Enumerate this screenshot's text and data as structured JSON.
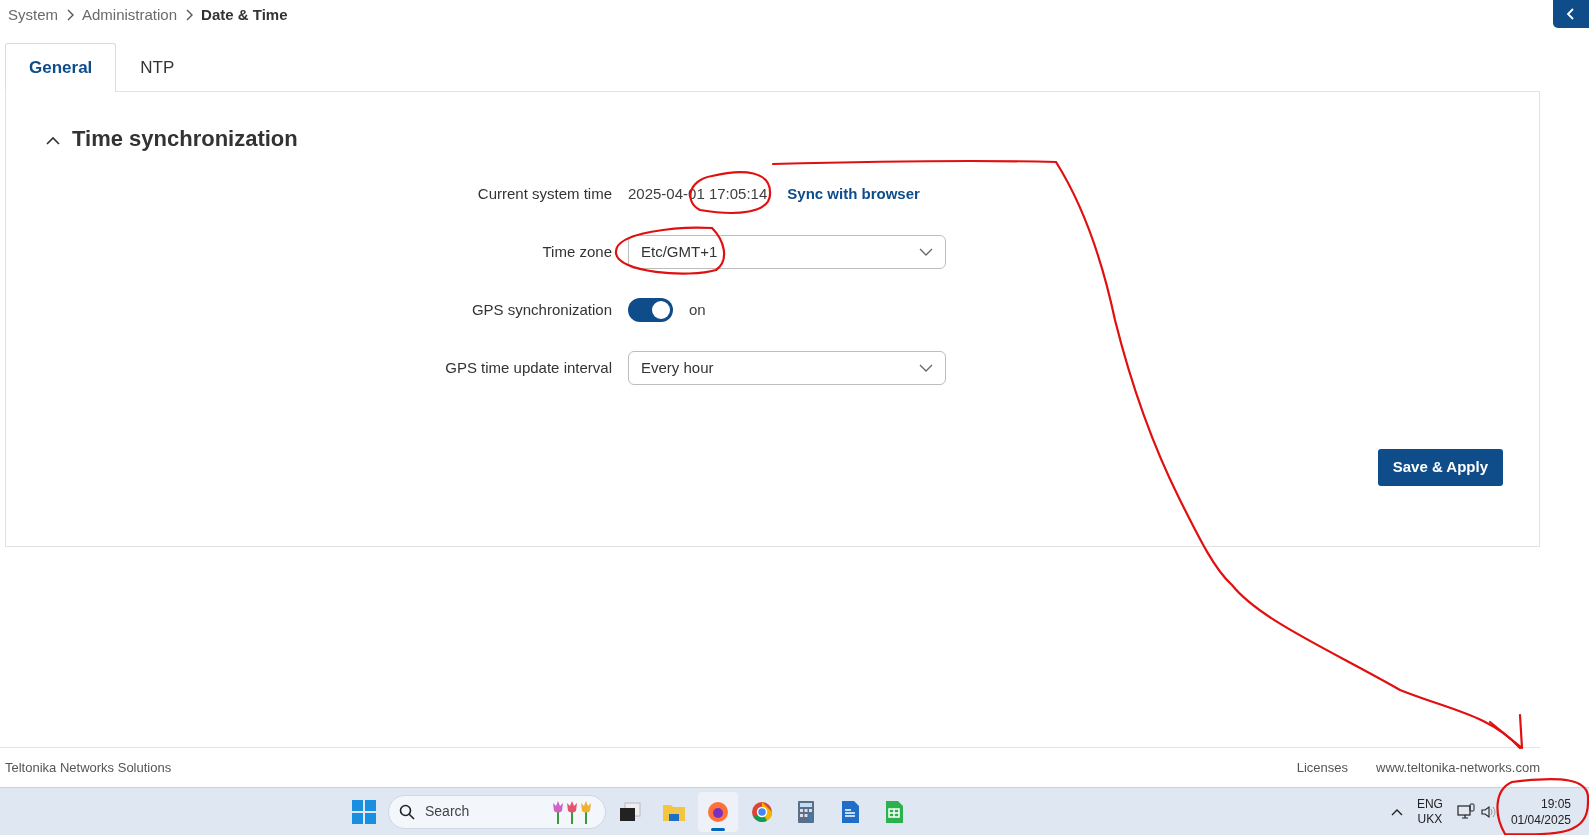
{
  "breadcrumb": [
    {
      "label": "System",
      "current": false
    },
    {
      "label": "Administration",
      "current": false
    },
    {
      "label": "Date & Time",
      "current": true
    }
  ],
  "tabs": [
    {
      "label": "General",
      "selected": true
    },
    {
      "label": "NTP",
      "selected": false
    }
  ],
  "section": {
    "title": "Time synchronization",
    "expanded": true
  },
  "fields": [
    {
      "kind": "time",
      "label": "Current system time",
      "value": "2025-04-01 17:05:14",
      "link": "Sync with browser"
    },
    {
      "kind": "select",
      "label": "Time zone",
      "value": "Etc/GMT+1"
    },
    {
      "kind": "switch",
      "label": "GPS synchronization",
      "on": true,
      "state_text": "on"
    },
    {
      "kind": "select",
      "label": "GPS time update interval",
      "value": "Every hour"
    }
  ],
  "save_button": "Save & Apply",
  "footer": {
    "company": "Teltonika Networks Solutions",
    "links": [
      "Licenses",
      "www.teltonika-networks.com"
    ]
  },
  "taskbar": {
    "search": {
      "placeholder": "Search"
    },
    "apps": [
      {
        "kind": "task-view",
        "selected": false
      },
      {
        "kind": "folder",
        "selected": false
      },
      {
        "kind": "fox-browser",
        "selected": true
      },
      {
        "kind": "round-browser",
        "selected": false
      },
      {
        "kind": "calculator",
        "selected": false
      },
      {
        "kind": "writer",
        "selected": false
      },
      {
        "kind": "sheet",
        "selected": false
      }
    ],
    "language": [
      "ENG",
      "UKX"
    ],
    "clock": {
      "time": "19:05",
      "date": "01/04/2025"
    }
  }
}
